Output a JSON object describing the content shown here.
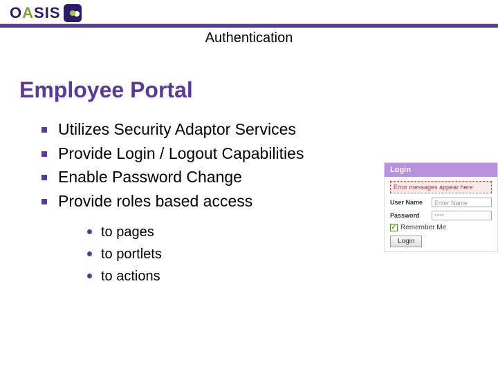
{
  "header": {
    "logo_text": "OASIS",
    "subtitle": "Authentication"
  },
  "title": "Employee Portal",
  "bullets": [
    "Utilizes Security Adaptor Services",
    "Provide Login / Logout Capabilities",
    "Enable Password Change",
    "Provide roles based access"
  ],
  "sub_bullets": [
    "to pages",
    "to portlets",
    "to actions"
  ],
  "login": {
    "title": "Login",
    "error": "Error messages appear here",
    "user_label": "User Name",
    "user_placeholder": "Enter Name",
    "pass_label": "Password",
    "pass_placeholder": "****",
    "remember_label": "Remember Me",
    "button_label": "Login"
  }
}
